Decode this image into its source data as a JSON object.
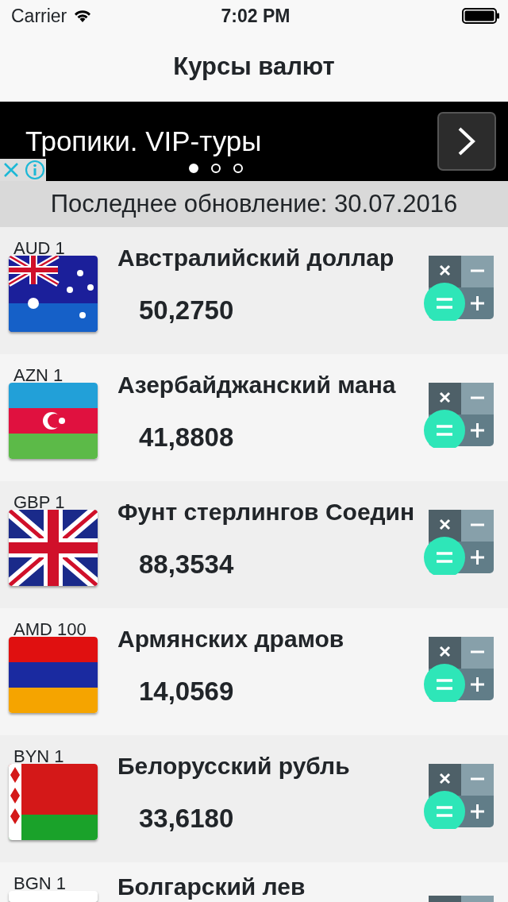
{
  "status_bar": {
    "carrier": "Carrier",
    "time": "7:02 PM"
  },
  "nav": {
    "title": "Курсы валют"
  },
  "ad": {
    "text": "Тропики. VIP-туры",
    "pages": [
      {
        "selected": true
      },
      {
        "selected": false
      },
      {
        "selected": false
      }
    ]
  },
  "update_bar": {
    "text": "Последнее обновление: 30.07.2016"
  },
  "currencies": [
    {
      "code": "AUD 1",
      "name": "Австралийский доллар",
      "rate": "50,2750"
    },
    {
      "code": "AZN 1",
      "name": "Азербайджанский мана",
      "rate": "41,8808"
    },
    {
      "code": "GBP 1",
      "name": "Фунт стерлингов Соедин",
      "rate": "88,3534"
    },
    {
      "code": "AMD 100",
      "name": "Армянских драмов",
      "rate": "14,0569"
    },
    {
      "code": "BYN 1",
      "name": "Белорусский рубль",
      "rate": "33,6180"
    },
    {
      "code": "BGN 1",
      "name": "Болгарский лев"
    }
  ]
}
